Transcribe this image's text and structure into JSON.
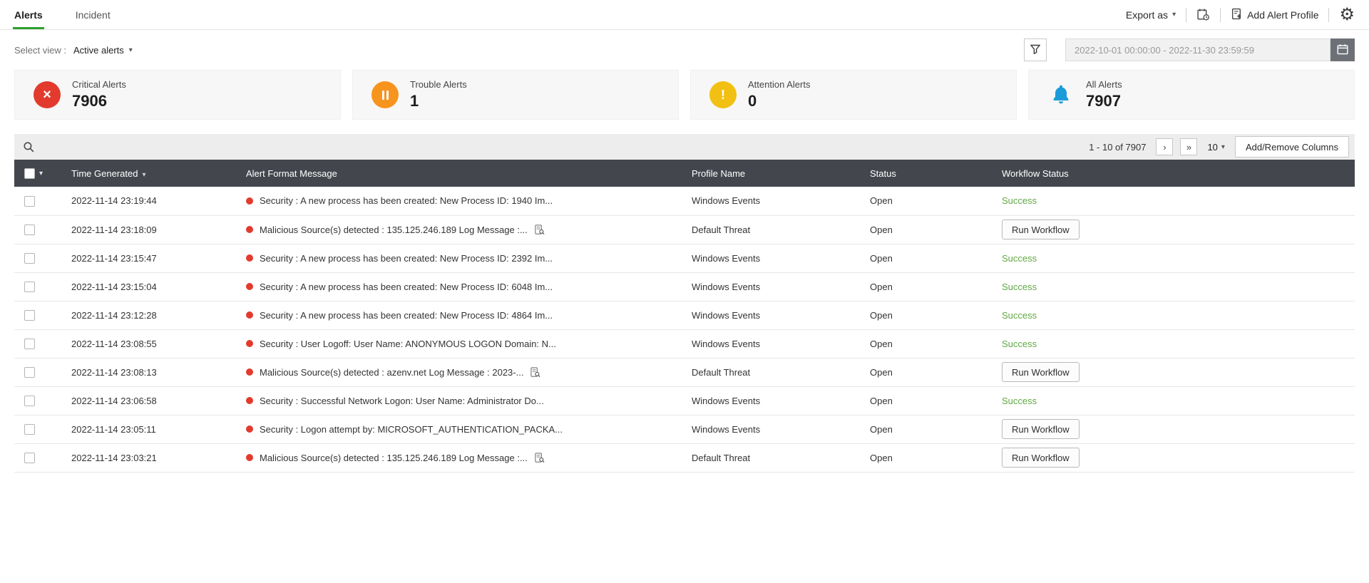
{
  "tabs": {
    "alerts": "Alerts",
    "incident": "Incident"
  },
  "topbar": {
    "export_label": "Export as",
    "add_alert_profile_label": "Add Alert Profile"
  },
  "view": {
    "label": "Select view :",
    "selected": "Active alerts"
  },
  "filters": {
    "date_range": "2022-10-01 00:00:00 - 2022-11-30 23:59:59"
  },
  "cards": [
    {
      "label": "Critical Alerts",
      "value": "7906"
    },
    {
      "label": "Trouble Alerts",
      "value": "1"
    },
    {
      "label": "Attention Alerts",
      "value": "0"
    },
    {
      "label": "All Alerts",
      "value": "7907"
    }
  ],
  "toolbar": {
    "pagination": "1 - 10 of 7907",
    "page_size": "10",
    "add_remove_columns": "Add/Remove Columns"
  },
  "table": {
    "columns": {
      "time": "Time Generated",
      "message": "Alert Format Message",
      "profile": "Profile Name",
      "status": "Status",
      "workflow": "Workflow Status"
    },
    "rows": [
      {
        "time": "2022-11-14 23:19:44",
        "message": "Security : A new process has been created: New Process ID: 1940 Im...",
        "profile": "Windows Events",
        "status": "Open",
        "workflow": "Success",
        "workflow_type": "success",
        "has_log_search_icon": false
      },
      {
        "time": "2022-11-14 23:18:09",
        "message": "Malicious Source(s) detected : 135.125.246.189 Log Message :...",
        "profile": "Default Threat",
        "status": "Open",
        "workflow": "Run Workflow",
        "workflow_type": "button",
        "has_log_search_icon": true
      },
      {
        "time": "2022-11-14 23:15:47",
        "message": "Security : A new process has been created: New Process ID: 2392 Im...",
        "profile": "Windows Events",
        "status": "Open",
        "workflow": "Success",
        "workflow_type": "success",
        "has_log_search_icon": false
      },
      {
        "time": "2022-11-14 23:15:04",
        "message": "Security : A new process has been created: New Process ID: 6048 Im...",
        "profile": "Windows Events",
        "status": "Open",
        "workflow": "Success",
        "workflow_type": "success",
        "has_log_search_icon": false
      },
      {
        "time": "2022-11-14 23:12:28",
        "message": "Security : A new process has been created: New Process ID: 4864 Im...",
        "profile": "Windows Events",
        "status": "Open",
        "workflow": "Success",
        "workflow_type": "success",
        "has_log_search_icon": false
      },
      {
        "time": "2022-11-14 23:08:55",
        "message": "Security : User Logoff: User Name: ANONYMOUS LOGON Domain: N...",
        "profile": "Windows Events",
        "status": "Open",
        "workflow": "Success",
        "workflow_type": "success",
        "has_log_search_icon": false
      },
      {
        "time": "2022-11-14 23:08:13",
        "message": "Malicious Source(s) detected : azenv.net Log Message : 2023-...",
        "profile": "Default Threat",
        "status": "Open",
        "workflow": "Run Workflow",
        "workflow_type": "button",
        "has_log_search_icon": true
      },
      {
        "time": "2022-11-14 23:06:58",
        "message": "Security : Successful Network Logon: User Name: Administrator Do...",
        "profile": "Windows Events",
        "status": "Open",
        "workflow": "Success",
        "workflow_type": "success",
        "has_log_search_icon": false
      },
      {
        "time": "2022-11-14 23:05:11",
        "message": "Security : Logon attempt by: MICROSOFT_AUTHENTICATION_PACKA...",
        "profile": "Windows Events",
        "status": "Open",
        "workflow": "Run Workflow",
        "workflow_type": "button",
        "has_log_search_icon": false
      },
      {
        "time": "2022-11-14 23:03:21",
        "message": "Malicious Source(s) detected : 135.125.246.189 Log Message :...",
        "profile": "Default Threat",
        "status": "Open",
        "workflow": "Run Workflow",
        "workflow_type": "button",
        "has_log_search_icon": true
      }
    ]
  },
  "colors": {
    "accent_green": "#2ba12b",
    "critical_red": "#e23b2e",
    "trouble_orange": "#f7941d",
    "attention_yellow": "#f2c012",
    "info_blue": "#1b9cd8",
    "success_green": "#61a944"
  }
}
